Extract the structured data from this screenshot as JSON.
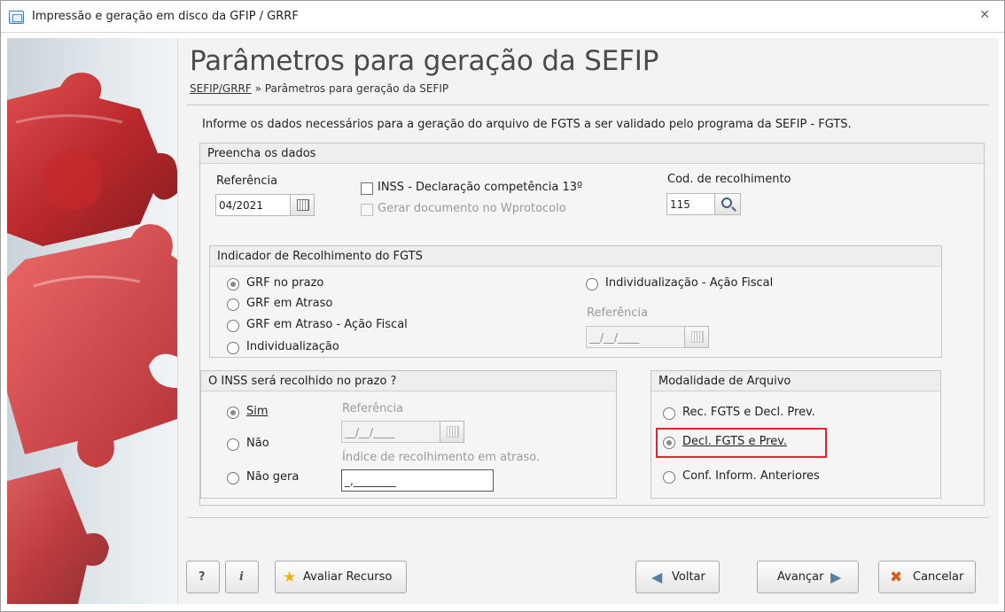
{
  "window": {
    "title": "Impressão e geração em disco da GFIP / GRRF",
    "close_glyph": "✕"
  },
  "header": {
    "page_title": "Parâmetros para geração da SEFIP",
    "breadcrumb_link": "SEFIP/GRRF",
    "breadcrumb_sep": " » ",
    "breadcrumb_current": "Parâmetros para geração da SEFIP"
  },
  "info_text": "Informe os dados necessários para a geração do arquivo de FGTS a ser validado pelo programa da SEFIP - FGTS.",
  "dados": {
    "group_title": "Preencha os dados",
    "referencia_label": "Referência",
    "referencia_value": "04/2021",
    "inss_13_label": "INSS - Declaração competência 13º",
    "inss_13_checked": false,
    "wprotocolo_label": "Gerar documento no Wprotocolo",
    "wprotocolo_enabled": false,
    "cod_label": "Cod. de recolhimento",
    "cod_value": "115"
  },
  "indicador": {
    "group_title": "Indicador de Recolhimento do FGTS",
    "options": [
      "GRF no prazo",
      "GRF em Atraso",
      "GRF em Atraso - Ação Fiscal",
      "Individualização"
    ],
    "option_acao_fiscal": "Individualização - Ação Fiscal",
    "selected": "GRF no prazo",
    "referencia_label": "Referência",
    "referencia_value": "__/__/____"
  },
  "inss": {
    "group_title": "O INSS será recolhido no prazo ?",
    "sim_label": "Sim",
    "nao_label": "Não",
    "nao_gera_label": "Não gera",
    "selected": "Sim",
    "referencia_label": "Referência",
    "referencia_value": "__/__/____",
    "indice_label": "Índice de recolhimento em atraso.",
    "indice_value": "_,________"
  },
  "modalidade": {
    "group_title": "Modalidade de Arquivo",
    "options": [
      "Rec. FGTS e Decl. Prev.",
      "Decl. FGTS e Prev.",
      "Conf. Inform. Anteriores"
    ],
    "selected": "Decl. FGTS e Prev.",
    "highlight_color": "#d9262f"
  },
  "footer": {
    "help_label": "?",
    "info_label": "i",
    "avaliar_label": "Avaliar Recurso",
    "voltar_label": "Voltar",
    "avancar_label": "Avançar",
    "cancelar_label": "Cancelar"
  }
}
